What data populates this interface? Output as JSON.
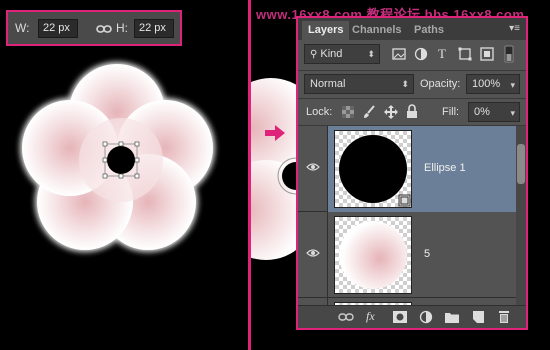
{
  "size_bar": {
    "width_label": "W:",
    "width_value": "22 px",
    "height_label": "H:",
    "height_value": "22 px",
    "link_icon": "link-icon"
  },
  "watermark": "www.16xx8.com 教程论坛 bbs.16xx8.com",
  "panel": {
    "tabs": [
      {
        "label": "Layers",
        "active": true
      },
      {
        "label": "Channels",
        "active": false
      },
      {
        "label": "Paths",
        "active": false
      }
    ],
    "menu_icon": "panel-menu-icon",
    "filter": {
      "kind_label": "Kind",
      "icons": [
        "image-filter-icon",
        "adjustment-filter-icon",
        "type-filter-icon",
        "shape-filter-icon",
        "smart-object-filter-icon",
        "filter-toggle-icon"
      ]
    },
    "blend_mode": "Normal",
    "opacity_label": "Opacity:",
    "opacity_value": "100%",
    "lock_label": "Lock:",
    "lock_icons": [
      "lock-transparent-icon",
      "lock-brush-icon",
      "lock-move-icon",
      "lock-all-icon"
    ],
    "fill_label": "Fill:",
    "fill_value": "0%",
    "layers": [
      {
        "name": "Ellipse 1",
        "selected": true,
        "visible": true
      },
      {
        "name": "5",
        "selected": false,
        "visible": true
      }
    ],
    "bottom_icons": [
      "link-layers-icon",
      "fx-icon",
      "mask-icon",
      "adjustment-icon",
      "group-folder-icon",
      "new-layer-icon",
      "trash-icon"
    ],
    "fx_label": "fx"
  },
  "colors": {
    "accent": "#e0237a",
    "panel_bg": "#535353",
    "selected_layer": "#6b7f98"
  }
}
